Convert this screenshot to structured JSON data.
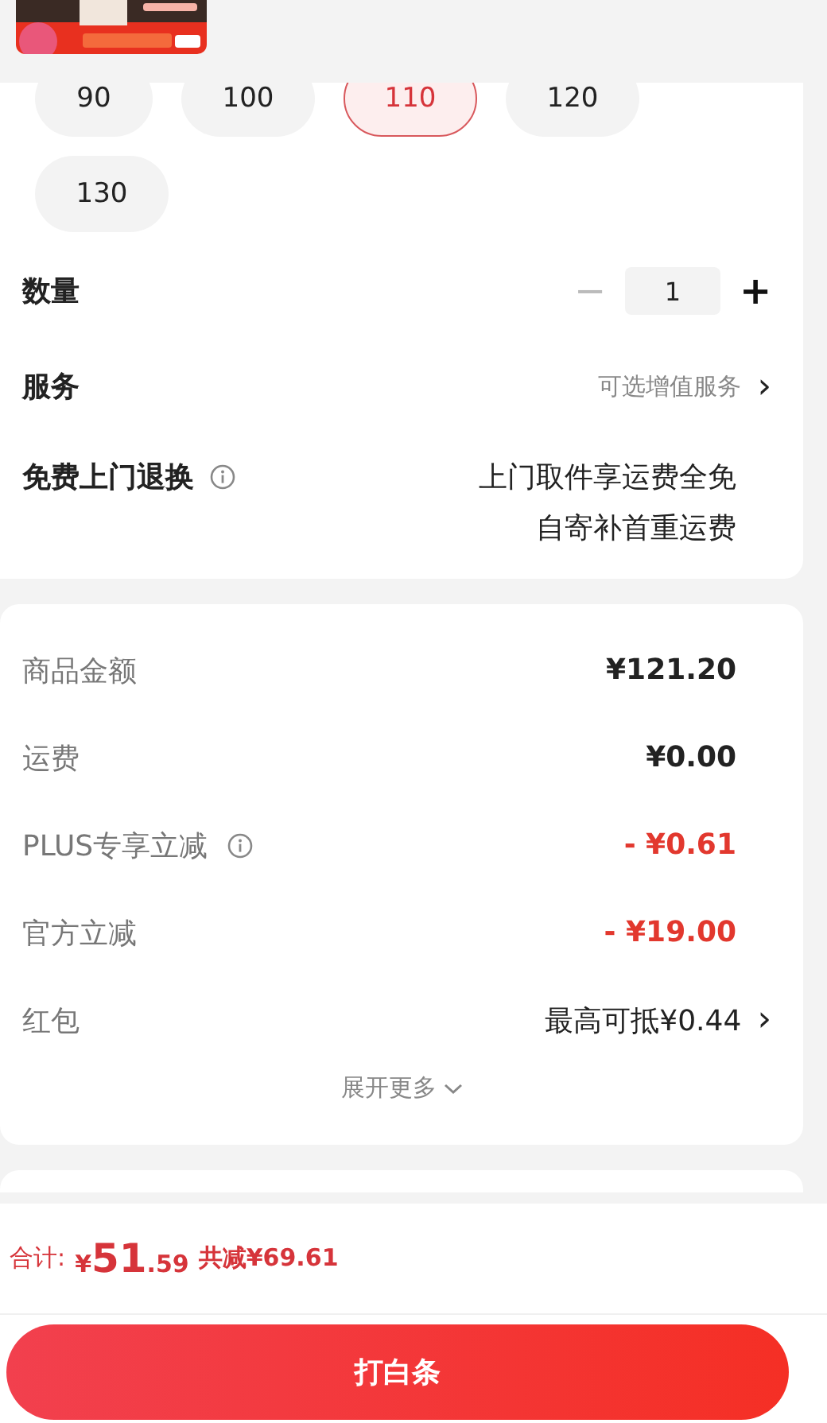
{
  "sizes": [
    {
      "label": "90",
      "selected": false
    },
    {
      "label": "100",
      "selected": false
    },
    {
      "label": "110",
      "selected": true
    },
    {
      "label": "120",
      "selected": false
    },
    {
      "label": "130",
      "selected": false
    }
  ],
  "quantity": {
    "label": "数量",
    "minus": "−",
    "value": "1",
    "plus": "+",
    "minus_disabled": true
  },
  "service": {
    "label": "服务",
    "value": "可选增值服务",
    "arrow": "›"
  },
  "return": {
    "label": "免费上门退换",
    "lines": [
      "上门取件享运费全免",
      "自寄补首重运费"
    ]
  },
  "price_rows": [
    {
      "label": "商品金额",
      "value": "¥121.20",
      "kind": "plain",
      "info": false
    },
    {
      "label": "运费",
      "value": "¥0.00",
      "kind": "plain",
      "info": false
    },
    {
      "label": "PLUS专享立减",
      "value": "- ¥0.61",
      "kind": "discount",
      "info": true
    },
    {
      "label": "官方立减",
      "value": "- ¥19.00",
      "kind": "discount",
      "info": false
    },
    {
      "label": "红包",
      "value": "最高可抵¥0.44",
      "kind": "link",
      "info": false,
      "arrow": "›"
    }
  ],
  "expand": {
    "label": "展开更多"
  },
  "footer": {
    "total_label": "合计:",
    "currency": "¥",
    "total_int": "51",
    "total_dec": ".59",
    "saved": "共减¥69.61",
    "button": "打白条"
  }
}
